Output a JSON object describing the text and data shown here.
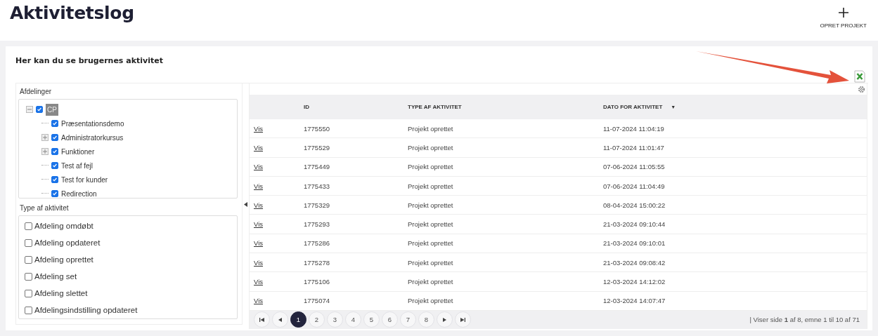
{
  "page": {
    "title": "Aktivitetslog",
    "create_button": "OPRET PROJEKT"
  },
  "card": {
    "description": "Her kan du se brugernes aktivitet"
  },
  "departments": {
    "label": "Afdelinger",
    "tree": [
      {
        "label": "CP",
        "checked": true,
        "expanded": true,
        "children": [
          {
            "label": "Præsentationsdemo",
            "checked": true
          },
          {
            "label": "Administratorkursus",
            "checked": true,
            "expanded": false
          },
          {
            "label": "Funktioner",
            "checked": true,
            "expanded": false
          },
          {
            "label": "Test af fejl",
            "checked": true
          },
          {
            "label": "Test for kunder",
            "checked": true
          },
          {
            "label": "Redirection",
            "checked": true
          }
        ]
      }
    ]
  },
  "activity_types": {
    "label": "Type af aktivitet",
    "items": [
      {
        "label": "Afdeling omdøbt",
        "checked": false
      },
      {
        "label": "Afdeling opdateret",
        "checked": false
      },
      {
        "label": "Afdeling oprettet",
        "checked": false
      },
      {
        "label": "Afdeling set",
        "checked": false
      },
      {
        "label": "Afdeling slettet",
        "checked": false
      },
      {
        "label": "Afdelingsindstilling opdateret",
        "checked": false
      }
    ]
  },
  "table": {
    "columns": [
      {
        "label": "ID"
      },
      {
        "label": "TYPE AF AKTIVITET"
      },
      {
        "label": "DATO FOR AKTIVITET",
        "sort_mark": "▼"
      }
    ],
    "rows": [
      {
        "link": "Vis",
        "id": "1775550",
        "type": "Projekt oprettet",
        "date": "11-07-2024 11:04:19"
      },
      {
        "link": "Vis",
        "id": "1775529",
        "type": "Projekt oprettet",
        "date": "11-07-2024 11:01:47"
      },
      {
        "link": "Vis",
        "id": "1775449",
        "type": "Projekt oprettet",
        "date": "07-06-2024 11:05:55"
      },
      {
        "link": "Vis",
        "id": "1775433",
        "type": "Projekt oprettet",
        "date": "07-06-2024 11:04:49"
      },
      {
        "link": "Vis",
        "id": "1775329",
        "type": "Projekt oprettet",
        "date": "08-04-2024 15:00:22"
      },
      {
        "link": "Vis",
        "id": "1775293",
        "type": "Projekt oprettet",
        "date": "21-03-2024 09:10:44"
      },
      {
        "link": "Vis",
        "id": "1775286",
        "type": "Projekt oprettet",
        "date": "21-03-2024 09:10:01"
      },
      {
        "link": "Vis",
        "id": "1775278",
        "type": "Projekt oprettet",
        "date": "21-03-2024 09:08:42"
      },
      {
        "link": "Vis",
        "id": "1775106",
        "type": "Projekt oprettet",
        "date": "12-03-2024 14:12:02"
      },
      {
        "link": "Vis",
        "id": "1775074",
        "type": "Projekt oprettet",
        "date": "12-03-2024 14:07:47"
      }
    ]
  },
  "pager": {
    "pages": [
      {
        "label": "1",
        "selected": true
      },
      {
        "label": "2",
        "selected": false
      },
      {
        "label": "3",
        "selected": false
      },
      {
        "label": "4",
        "selected": false
      },
      {
        "label": "5",
        "selected": false
      },
      {
        "label": "6",
        "selected": false
      },
      {
        "label": "7",
        "selected": false
      },
      {
        "label": "8",
        "selected": false
      }
    ],
    "status": "| Viser side **1** af 8, emne 1 til 10 af 71"
  }
}
